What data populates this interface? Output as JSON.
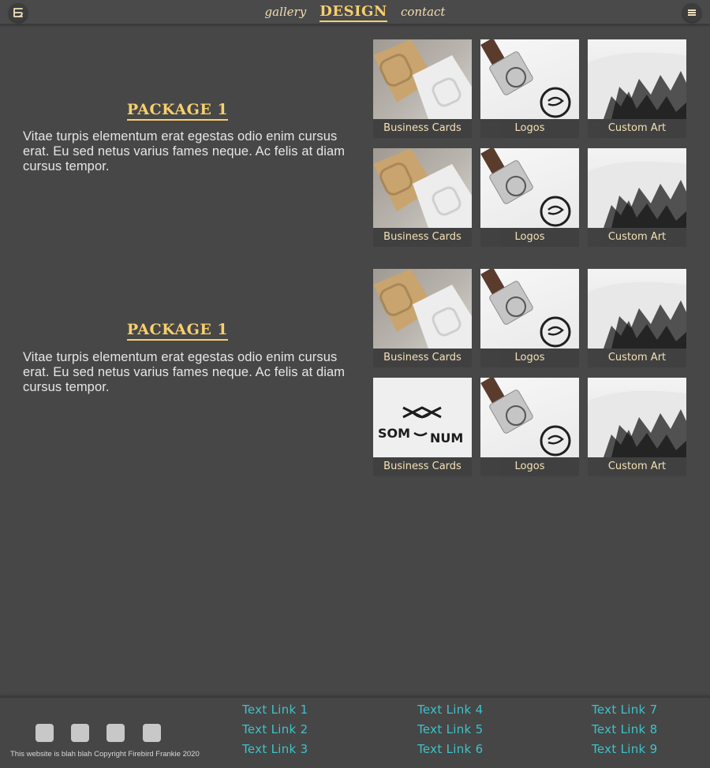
{
  "header": {
    "logo_icon": "firebird-logo-icon",
    "nav": [
      {
        "label": "gallery",
        "active": false
      },
      {
        "label": "DESIGN",
        "active": true
      },
      {
        "label": "contact",
        "active": false
      }
    ],
    "menu_icon": "hamburger-menu-icon"
  },
  "packages": [
    {
      "title": "PACKAGE 1",
      "description": "Vitae turpis elementum erat egestas odio enim cursus erat. Eu sed netus varius fames neque. Ac felis at diam cursus tempor.",
      "tiles": [
        {
          "caption": "Business Cards",
          "image": "business-card-mockup"
        },
        {
          "caption": "Logos",
          "image": "stamp-mockup"
        },
        {
          "caption": "Custom Art",
          "image": "tshirt-art-mockup"
        },
        {
          "caption": "Business Cards",
          "image": "business-card-mockup"
        },
        {
          "caption": "Logos",
          "image": "stamp-mockup"
        },
        {
          "caption": "Custom Art",
          "image": "tshirt-art-mockup"
        }
      ]
    },
    {
      "title": "PACKAGE 1",
      "description": "Vitae turpis elementum erat egestas odio enim cursus erat. Eu sed netus varius fames neque. Ac felis at diam cursus tempor.",
      "tiles": [
        {
          "caption": "Business Cards",
          "image": "business-card-mockup"
        },
        {
          "caption": "Logos",
          "image": "stamp-mockup"
        },
        {
          "caption": "Custom Art",
          "image": "tshirt-art-mockup"
        },
        {
          "caption": "Business Cards",
          "image": "som-num-logo-mockup",
          "logo_text": "SOM",
          "logo_text_2": "NUM"
        },
        {
          "caption": "Logos",
          "image": "stamp-mockup"
        },
        {
          "caption": "Custom Art",
          "image": "tshirt-art-mockup"
        }
      ]
    }
  ],
  "footer": {
    "social_icons": [
      "social-icon-1",
      "social-icon-2",
      "social-icon-3",
      "social-icon-4"
    ],
    "copyright": "This website is blah blah Copyright Firebird Frankie 2020",
    "links": [
      "Text Link 1",
      "Text Link 2",
      "Text Link 3",
      "Text Link 4",
      "Text Link 5",
      "Text Link 6",
      "Text Link 7",
      "Text Link 8",
      "Text Link 9"
    ]
  },
  "colors": {
    "background": "#474747",
    "accent": "#f7cf6e",
    "link": "#3ec2c9"
  }
}
